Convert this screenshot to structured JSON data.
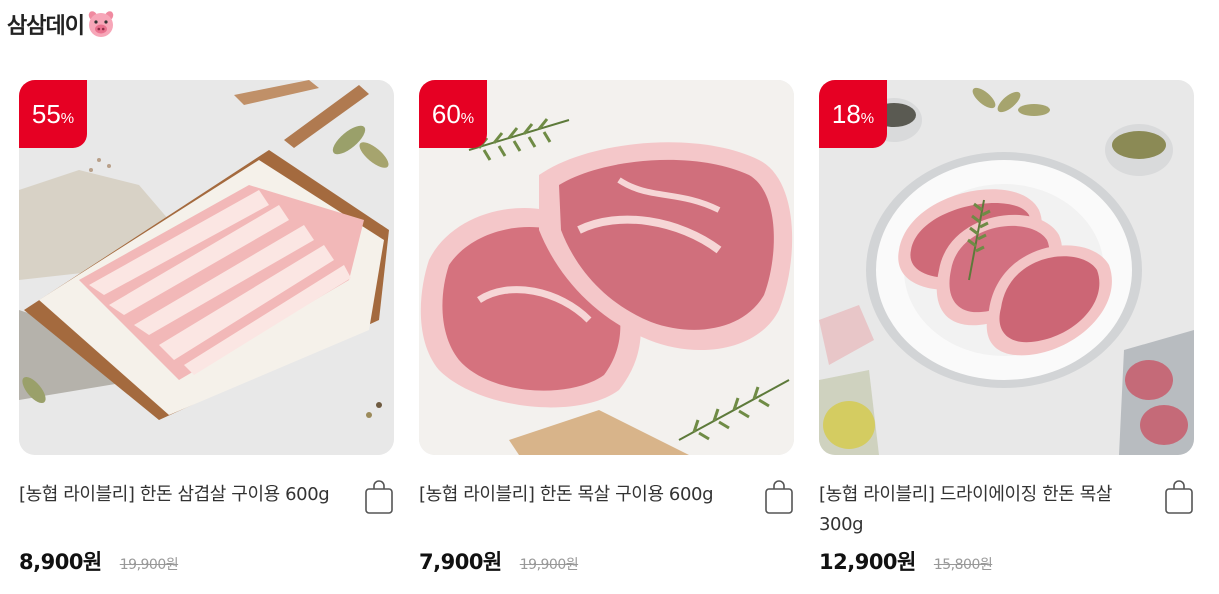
{
  "section": {
    "title": "삼삼데이",
    "emoji_icon": "pig-face-icon"
  },
  "products": [
    {
      "name": "[농협 라이블리] 한돈 삼겹살 구이용 600g",
      "discount": "55",
      "discount_unit": "%",
      "price": "8,900원",
      "original_price": "19,900원",
      "image": "pork-belly-image",
      "cart_icon": "shopping-bag-icon"
    },
    {
      "name": "[농협 라이블리] 한돈 목살 구이용 600g",
      "discount": "60",
      "discount_unit": "%",
      "price": "7,900원",
      "original_price": "19,900원",
      "image": "pork-neck-image",
      "cart_icon": "shopping-bag-icon"
    },
    {
      "name": "[농협 라이블리] 드라이에이징 한돈 목살 300g",
      "discount": "18",
      "discount_unit": "%",
      "price": "12,900원",
      "original_price": "15,800원",
      "image": "dry-aged-pork-neck-image",
      "cart_icon": "shopping-bag-icon"
    }
  ],
  "colors": {
    "badge": "#e60023",
    "price": "#111111",
    "old_price": "#999999"
  }
}
